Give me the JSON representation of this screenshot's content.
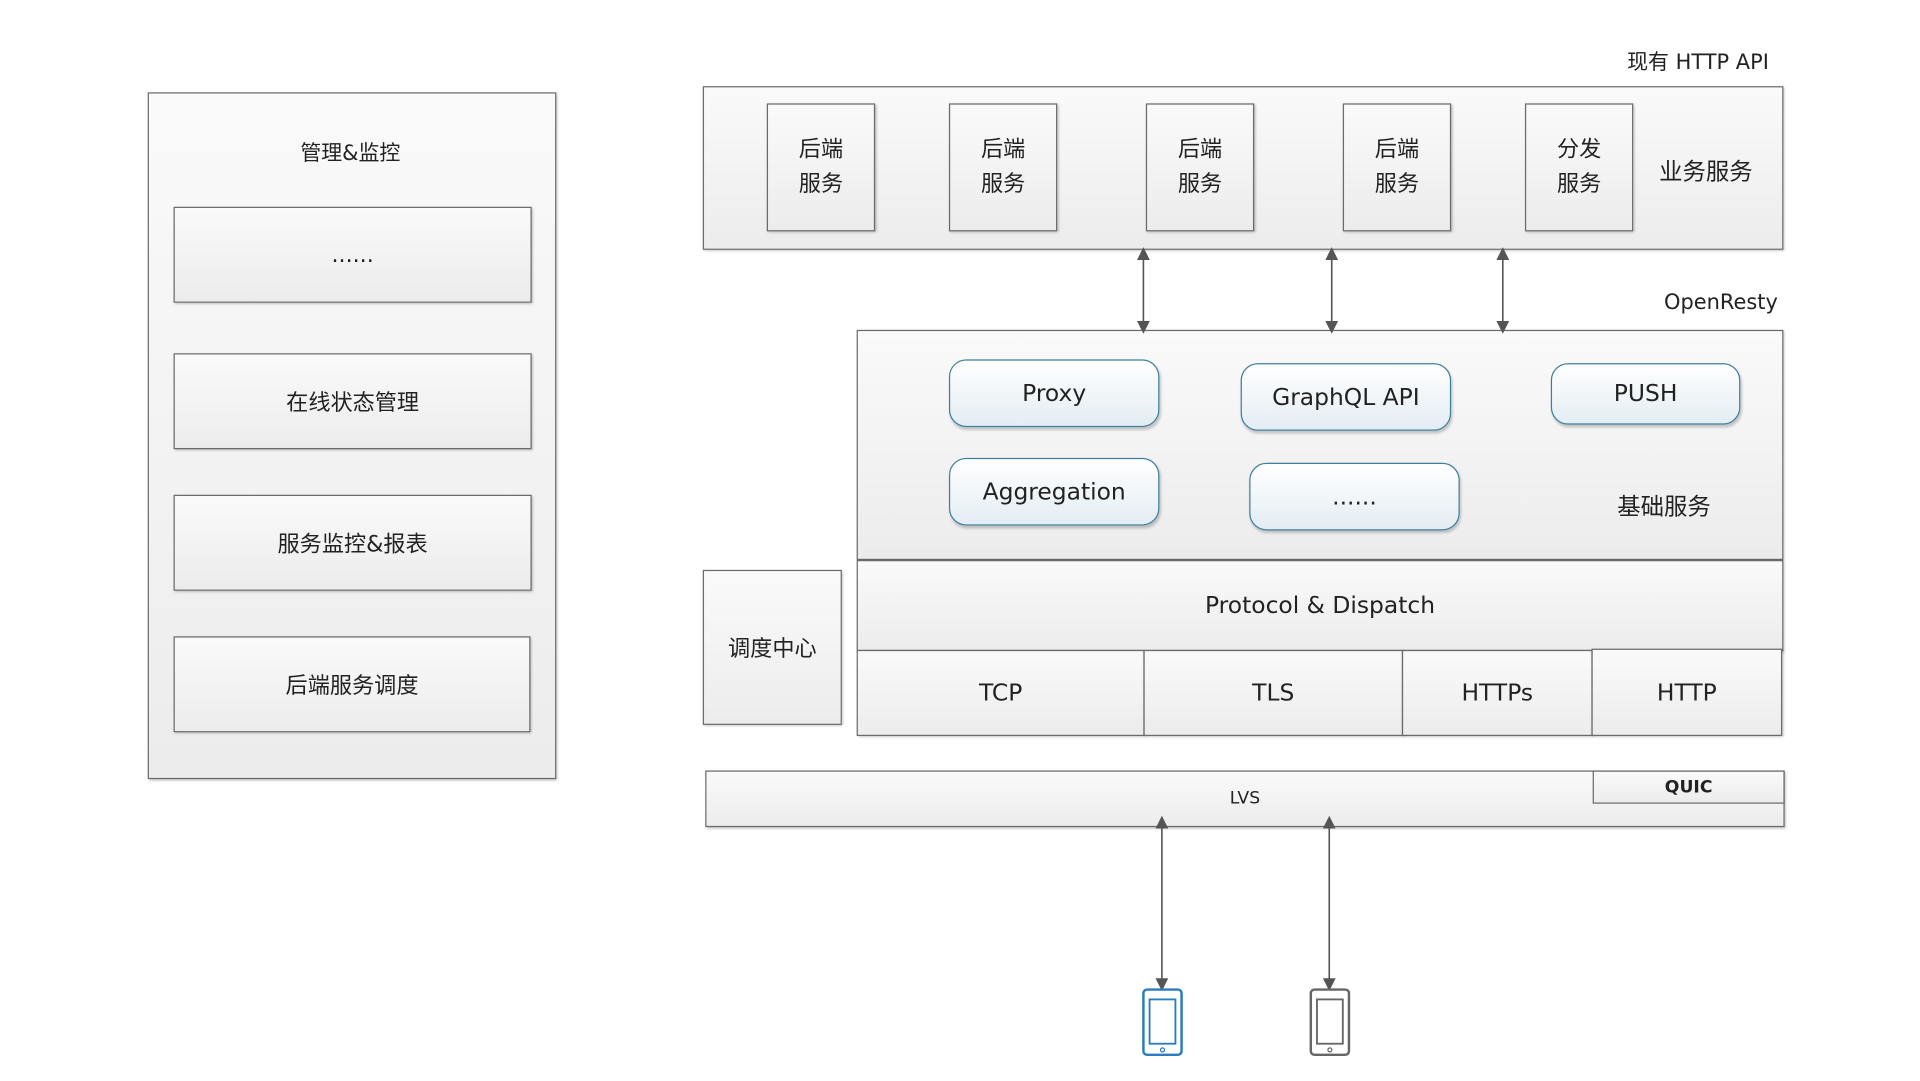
{
  "management": {
    "title": "管理&监控",
    "items": [
      "......",
      "在线状态管理",
      "服务监控&报表",
      "后端服务调度"
    ]
  },
  "business": {
    "header": "现有 HTTP API",
    "label": "业务服务",
    "services": [
      {
        "line1": "后端",
        "line2": "服务"
      },
      {
        "line1": "后端",
        "line2": "服务"
      },
      {
        "line1": "后端",
        "line2": "服务"
      },
      {
        "line1": "后端",
        "line2": "服务"
      },
      {
        "line1": "分发",
        "line2": "服务"
      }
    ]
  },
  "openresty": {
    "header": "OpenResty",
    "base_label": "基础服务",
    "modules": [
      "Proxy",
      "GraphQL API",
      "PUSH",
      "Aggregation",
      "......"
    ],
    "protocol_dispatch": "Protocol & Dispatch",
    "protocols": [
      "TCP",
      "TLS",
      "HTTPs",
      "HTTP"
    ]
  },
  "scheduler": "调度中心",
  "lvs": {
    "label": "LVS",
    "quic": "QUIC"
  },
  "devices": [
    {
      "icon": "mobile-phone-icon",
      "color": "#2b7bbf"
    },
    {
      "icon": "mobile-phone-icon",
      "color": "#666666"
    }
  ]
}
